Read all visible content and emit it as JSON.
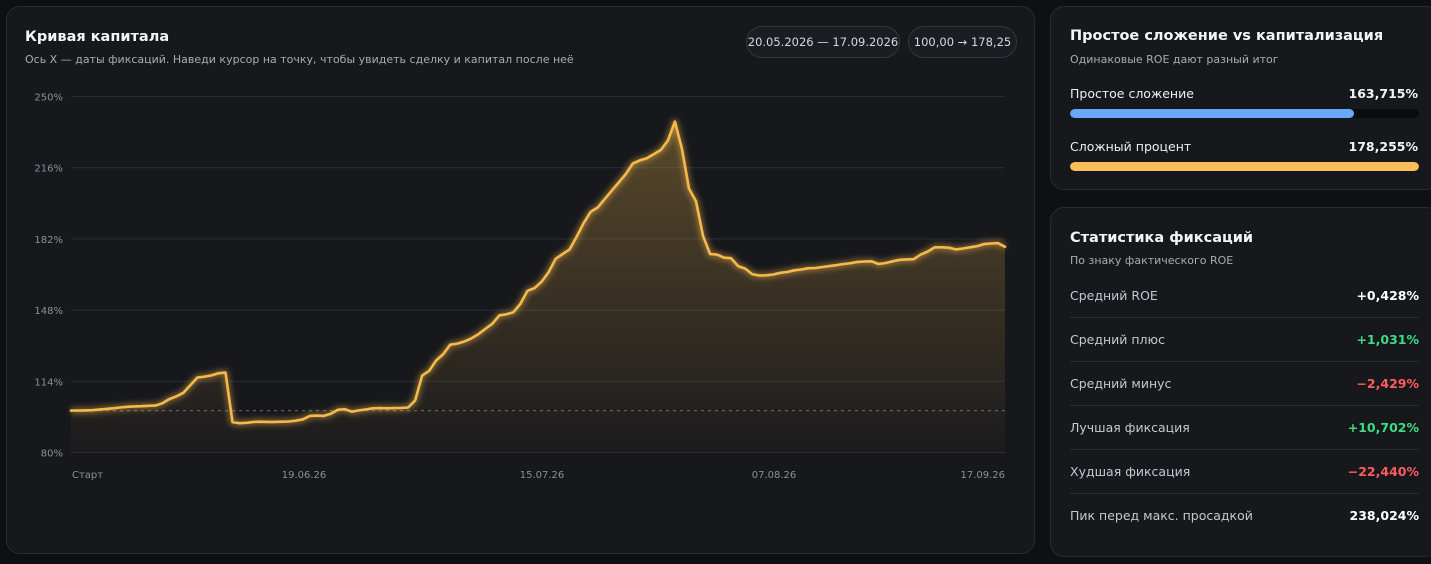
{
  "equity_card": {
    "title": "Кривая капитала",
    "subtitle": "Ось X — даты фиксаций. Наведи курсор на точку, чтобы увидеть сделку и капитал после неё",
    "date_range": "20.05.2026 — 17.09.2026",
    "capital_range": "100,00 → 178,25"
  },
  "colors": {
    "line": "#f5b94c",
    "simple": "#6aa8f7",
    "compound": "#fbbd5a",
    "positive": "#3ddc84",
    "negative": "#ff5d5d",
    "neutral": "#ffffff"
  },
  "chart_data": {
    "type": "area",
    "title": "Кривая капитала",
    "ylim": [
      80,
      250
    ],
    "yticks": [
      "250%",
      "216%",
      "182%",
      "148%",
      "114%",
      "80%"
    ],
    "ytick_values": [
      250,
      216,
      182,
      148,
      114,
      80
    ],
    "xticks": [
      "Старт",
      "19.06.26",
      "15.07.26",
      "07.08.26",
      "17.09.26"
    ],
    "baseline": 100,
    "grid": true,
    "series": [
      {
        "values": [
          100.0,
          100.0,
          100.1,
          100.2,
          100.5,
          100.8,
          101.1,
          101.5,
          101.8,
          102.0,
          102.1,
          102.3,
          102.4,
          103.5,
          105.5,
          106.8,
          108.5,
          112.2,
          115.8,
          116.2,
          116.8,
          117.8,
          118.2,
          94.5,
          94.0,
          94.2,
          94.6,
          94.7,
          94.6,
          94.6,
          94.7,
          94.8,
          95.2,
          95.8,
          97.5,
          97.6,
          97.5,
          98.5,
          100.4,
          100.7,
          99.5,
          100.1,
          100.6,
          101.1,
          101.2,
          101.1,
          101.2,
          101.3,
          101.5,
          104.8,
          116.7,
          119.0,
          124.0,
          127.0,
          131.5,
          132.0,
          133.0,
          134.5,
          136.5,
          139.0,
          141.5,
          145.5,
          146.0,
          147.0,
          151.0,
          157.2,
          158.5,
          161.5,
          166.0,
          172.5,
          174.8,
          177.0,
          183.0,
          189.5,
          195.0,
          197.0,
          201.0,
          205.0,
          209.0,
          213.0,
          218.0,
          219.5,
          220.5,
          222.5,
          224.5,
          229.0,
          238.02,
          225.0,
          206.0,
          200.0,
          183.5,
          174.8,
          174.5,
          173.0,
          172.8,
          169.0,
          167.8,
          165.2,
          164.5,
          164.6,
          165.0,
          165.8,
          166.2,
          167.0,
          167.4,
          168.0,
          168.1,
          168.6,
          169.0,
          169.5,
          170.0,
          170.4,
          171.0,
          171.2,
          171.3,
          170.0,
          170.5,
          171.3,
          172.0,
          172.2,
          172.3,
          174.5,
          176.0,
          178.0,
          178.0,
          177.8,
          177.0,
          177.4,
          178.0,
          178.5,
          179.5,
          179.8,
          180.0,
          178.25
        ]
      }
    ]
  },
  "compare_card": {
    "title": "Простое сложение vs капитализация",
    "subtitle": "Одинаковые ROE дают разный итог",
    "bars": [
      {
        "label": "Простое сложение",
        "value": "163,715%",
        "fraction": 0.815,
        "color_key": "simple"
      },
      {
        "label": "Сложный процент",
        "value": "178,255%",
        "fraction": 1.0,
        "color_key": "compound"
      }
    ]
  },
  "stats_card": {
    "title": "Статистика фиксаций",
    "subtitle": "По знаку фактического ROE",
    "rows": [
      {
        "label": "Средний ROE",
        "value": "+0,428%",
        "tone": "neutral"
      },
      {
        "label": "Средний плюс",
        "value": "+1,031%",
        "tone": "positive"
      },
      {
        "label": "Средний минус",
        "value": "−2,429%",
        "tone": "negative"
      },
      {
        "label": "Лучшая фиксация",
        "value": "+10,702%",
        "tone": "positive"
      },
      {
        "label": "Худшая фиксация",
        "value": "−22,440%",
        "tone": "negative"
      },
      {
        "label": "Пик перед макс. просадкой",
        "value": "238,024%",
        "tone": "neutral"
      }
    ]
  }
}
